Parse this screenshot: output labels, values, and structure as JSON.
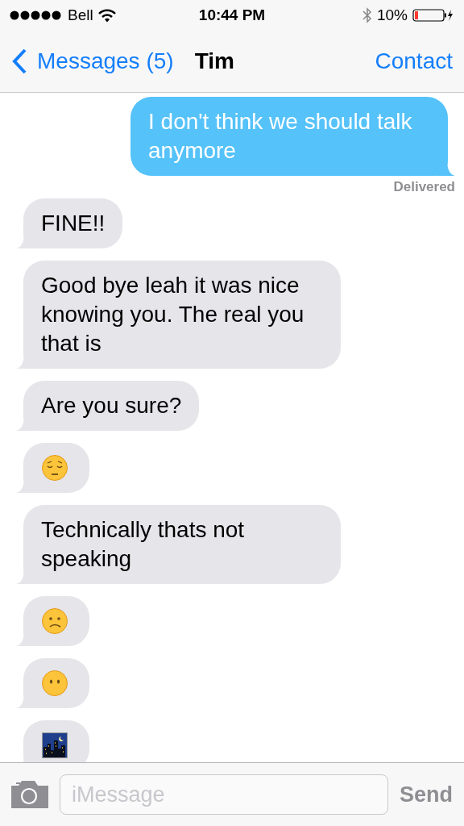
{
  "status_bar": {
    "carrier": "Bell",
    "time": "10:44 PM",
    "battery": "10%"
  },
  "nav": {
    "back": "Messages (5)",
    "title": "Tim",
    "action": "Contact"
  },
  "messages": [
    {
      "outgoing": true,
      "kind": "text",
      "text": "I don't think we should talk anymore"
    },
    {
      "kind": "receipt",
      "text": "Delivered"
    },
    {
      "outgoing": false,
      "kind": "text",
      "text": "FINE!!"
    },
    {
      "outgoing": false,
      "kind": "text",
      "text": "Good bye leah it was nice knowing you. The real you that is"
    },
    {
      "outgoing": false,
      "kind": "text",
      "text": "Are you sure?"
    },
    {
      "outgoing": false,
      "kind": "pensive-face"
    },
    {
      "outgoing": false,
      "kind": "text",
      "text": "Technically thats not speaking"
    },
    {
      "outgoing": false,
      "kind": "confused-face"
    },
    {
      "outgoing": false,
      "kind": "blank-face"
    },
    {
      "outgoing": false,
      "kind": "city-night"
    }
  ],
  "composer": {
    "placeholder": "iMessage",
    "send": "Send"
  }
}
